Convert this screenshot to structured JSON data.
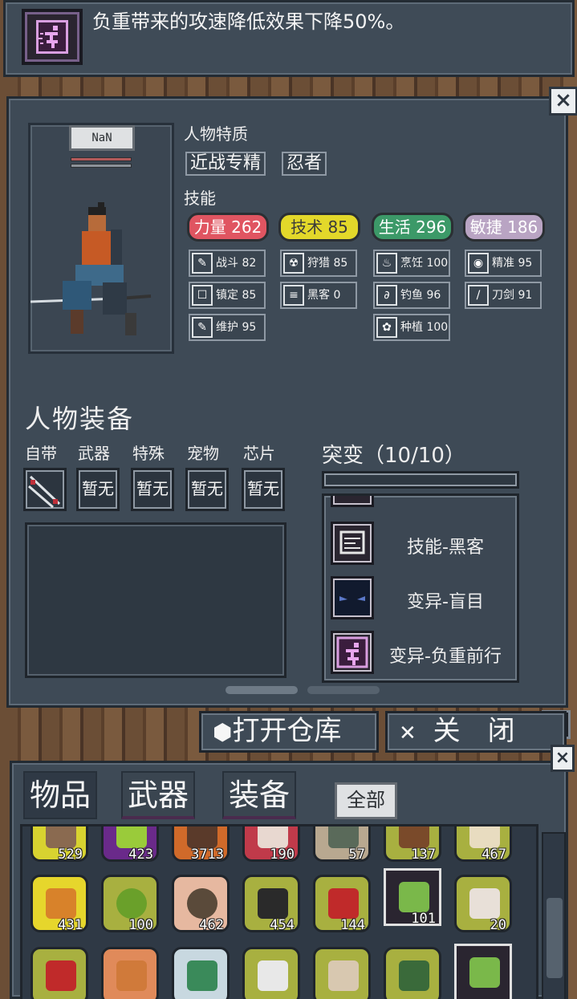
{
  "tooltip": {
    "text": "负重带来的攻速降低效果下降50%。",
    "icon": "running-figure-icon"
  },
  "character": {
    "name": "NaN",
    "traits_label": "人物特质",
    "traits": [
      "近战专精",
      "忍者"
    ],
    "skills_label": "技能",
    "stats": [
      {
        "label": "力量 262",
        "color": "#e05561"
      },
      {
        "label": "技术 85",
        "color": "#e3d82a"
      },
      {
        "label": "生活 296",
        "color": "#3c9968"
      },
      {
        "label": "敏捷 186",
        "color": "#b9a4c3"
      }
    ],
    "subskills": [
      {
        "label": "战斗 82",
        "icon": "wrench-icon"
      },
      {
        "label": "狩猎 85",
        "icon": "hazard-icon"
      },
      {
        "label": "烹饪 100",
        "icon": "cooking-pot-icon"
      },
      {
        "label": "精准 95",
        "icon": "eye-icon"
      },
      {
        "label": "镇定 85",
        "icon": "bandage-icon"
      },
      {
        "label": "黑客 0",
        "icon": "circuit-icon"
      },
      {
        "label": "钓鱼 96",
        "icon": "fish-icon"
      },
      {
        "label": "刀剑 91",
        "icon": "blade-icon"
      },
      {
        "label": "维护 95",
        "icon": "wrench-icon"
      },
      {
        "label": "种植 100",
        "icon": "plant-icon"
      }
    ]
  },
  "equipment": {
    "title": "人物装备",
    "slot_labels": [
      "自带",
      "武器",
      "特殊",
      "宠物",
      "芯片"
    ],
    "slot_values": [
      "",
      "暂无",
      "暂无",
      "暂无",
      "暂无"
    ]
  },
  "mutations": {
    "title": "突变（10/10）",
    "items": [
      {
        "label": "技能-黑客",
        "icon": "circuit-icon"
      },
      {
        "label": "变异-盲目",
        "icon": "blind-eyes-icon"
      },
      {
        "label": "变异-负重前行",
        "icon": "running-figure-icon"
      }
    ]
  },
  "actions": {
    "open_storage": "打开仓库",
    "close": "关　闭",
    "close_x": "×"
  },
  "inventory": {
    "tabs": [
      "物品",
      "武器",
      "装备"
    ],
    "filter": "全部",
    "row1": [
      "529",
      "423",
      "3713",
      "190",
      "57",
      "137",
      "467"
    ],
    "row2": [
      "431",
      "100",
      "462",
      "454",
      "144",
      "101",
      "20"
    ],
    "row3": [
      "",
      "",
      "",
      "",
      "",
      "",
      ""
    ]
  }
}
